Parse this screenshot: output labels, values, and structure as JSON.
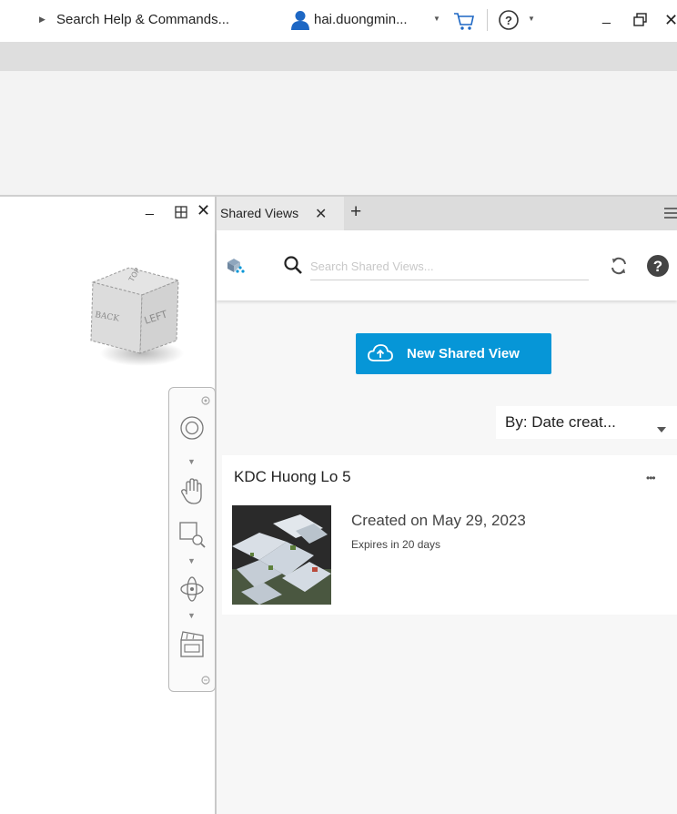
{
  "titlebar": {
    "search_label": "Search Help & Commands...",
    "user_name": "hai.duongmin...",
    "help_symbol": "?",
    "minimize": "_",
    "close": "✕"
  },
  "viewport": {
    "minimize": "_",
    "close": "✕",
    "viewcube_top_label": "TOP",
    "viewcube_front_label": "BACK",
    "viewcube_side_label": "LEFT"
  },
  "tabs": [
    {
      "label": "Shared Views",
      "close": "✕"
    }
  ],
  "tab_add": "+",
  "search": {
    "placeholder": "Search Shared Views..."
  },
  "new_button": {
    "label": "New Shared View"
  },
  "sort": {
    "label": "By: Date creat..."
  },
  "shared_views": [
    {
      "title": "KDC Huong Lo 5",
      "created": "Created on May 29, 2023",
      "expires": "Expires in 20 days",
      "more": "•••"
    }
  ],
  "colors": {
    "accent": "#0696d7",
    "user_icon": "#1d67c4"
  }
}
